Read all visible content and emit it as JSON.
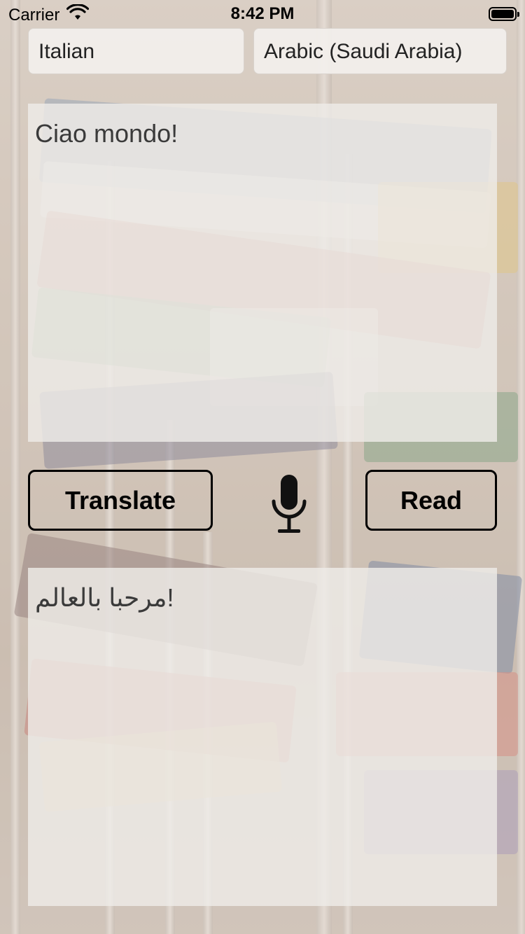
{
  "status_bar": {
    "carrier": "Carrier",
    "time": "8:42 PM",
    "wifi_icon": "wifi-icon",
    "battery_icon": "battery-icon",
    "battery_level": 1.0
  },
  "languages": {
    "source": "Italian",
    "target": "Arabic (Saudi Arabia)"
  },
  "source_text": "Ciao mondo!",
  "buttons": {
    "translate": "Translate",
    "read": "Read"
  },
  "mic_icon": "microphone-icon",
  "result_text": "مرحبا بالعالم!",
  "colors": {
    "button_border": "#000000",
    "field_bg": "#f3f0ed"
  }
}
